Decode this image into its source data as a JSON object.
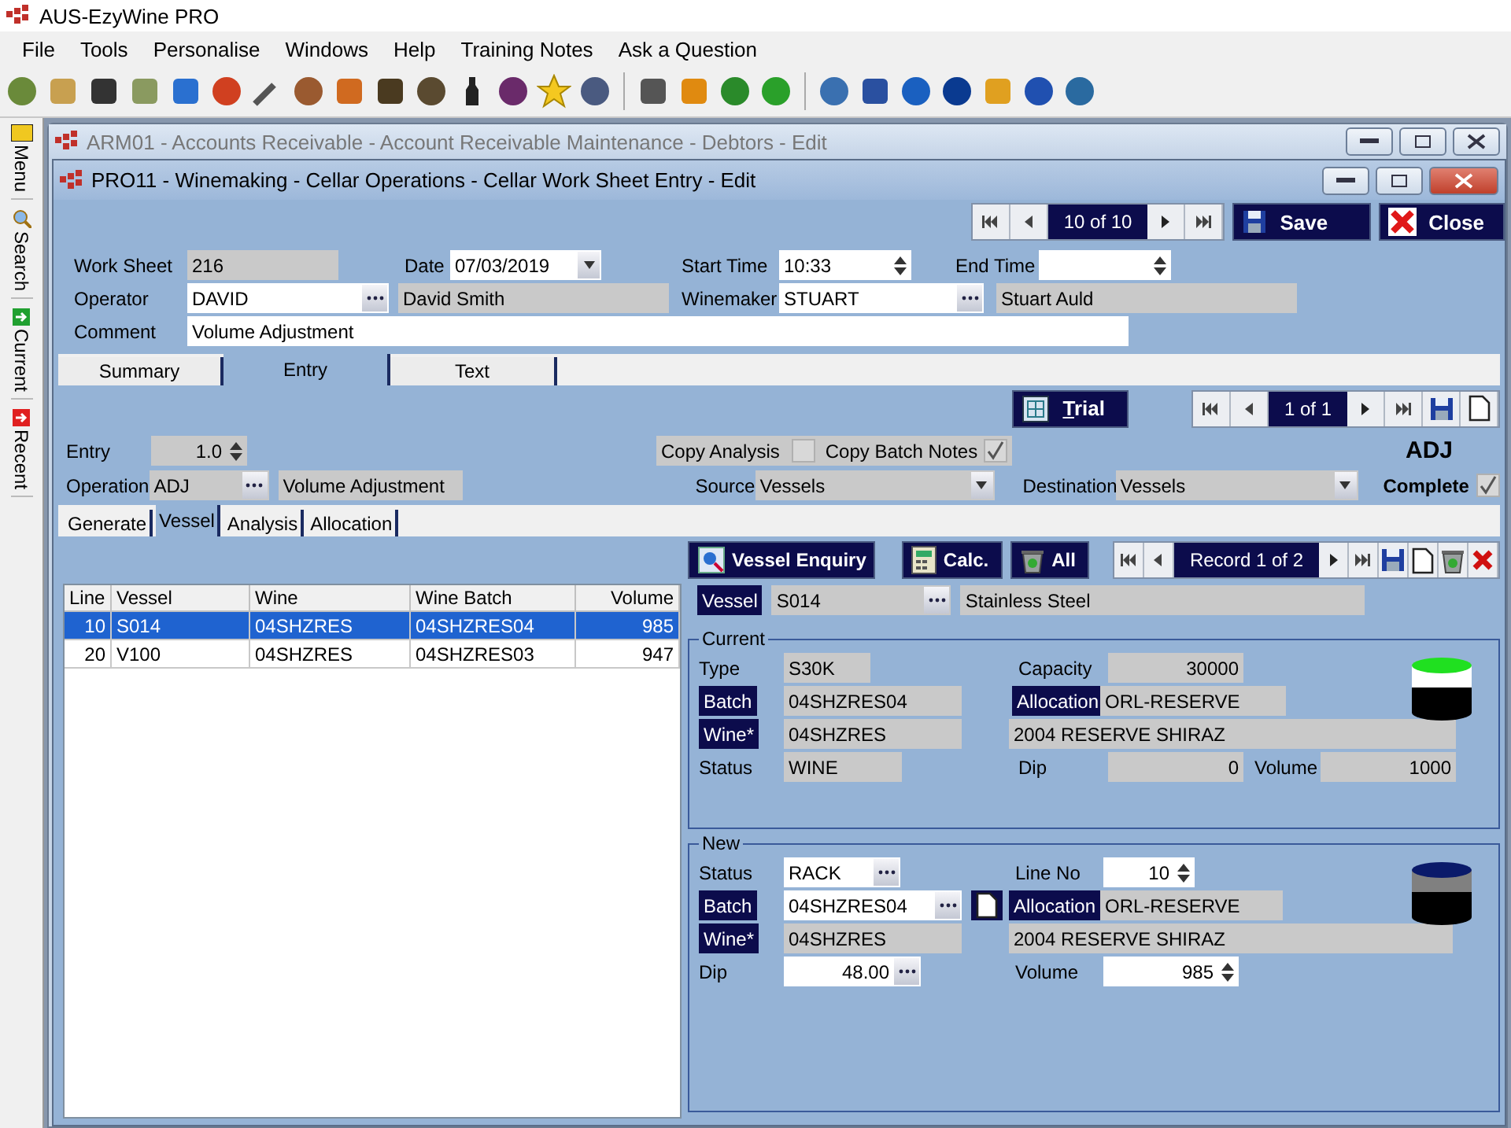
{
  "app": {
    "title": "AUS-EzyWine PRO",
    "menu": [
      "File",
      "Tools",
      "Personalise",
      "Windows",
      "Help",
      "Training Notes",
      "Ask a Question"
    ]
  },
  "sidebar": [
    {
      "label": "Menu"
    },
    {
      "label": "Search"
    },
    {
      "label": "Current"
    },
    {
      "label": "Recent"
    }
  ],
  "background_window": {
    "title": "ARM01 - Accounts Receivable - Account Receivable Maintenance - Debtors - Edit"
  },
  "window": {
    "title": "PRO11 - Winemaking - Cellar Operations - Cellar Work Sheet Entry - Edit",
    "record": "10 of 10",
    "buttons": [
      {
        "label": "Save",
        "kind": "save"
      },
      {
        "label": "Close",
        "kind": "close"
      }
    ]
  },
  "header": {
    "work_sheet": {
      "label": "Work Sheet",
      "value": "216"
    },
    "date": {
      "label": "Date",
      "value": "07/03/2019"
    },
    "start_time": {
      "label": "Start Time",
      "value": "10:33"
    },
    "end_time": {
      "label": "End Time"
    },
    "operator": {
      "label": "Operator",
      "value": "DAVID",
      "name": "David Smith"
    },
    "winemaker": {
      "label": "Winemaker",
      "value": "STUART",
      "name": "Stuart Auld"
    },
    "comment": {
      "label": "Comment",
      "value": "Volume Adjustment"
    }
  },
  "tabs": [
    {
      "label": "Summary",
      "selected": false
    },
    {
      "label": "Entry",
      "selected": true
    },
    {
      "label": "Text",
      "selected": false
    }
  ],
  "entry": {
    "trial_button": "Trial",
    "record": "1 of 1",
    "entry": {
      "label": "Entry",
      "value": "1.0"
    },
    "operation": {
      "label": "Operation",
      "value": "ADJ",
      "name": "Volume Adjustment"
    },
    "copy_analysis": {
      "label": "Copy Analysis",
      "checked": false
    },
    "copy_batch_notes": {
      "label": "Copy Batch Notes",
      "checked": true
    },
    "source": {
      "label": "Source",
      "value": "Vessels"
    },
    "destination": {
      "label": "Destination",
      "value": "Vessels"
    },
    "code": "ADJ",
    "complete": {
      "label": "Complete",
      "checked": true
    }
  },
  "subtabs": [
    {
      "label": "Generate",
      "selected": false
    },
    {
      "label": "Vessel",
      "selected": true
    },
    {
      "label": "Analysis",
      "selected": false
    },
    {
      "label": "Allocation",
      "selected": false
    }
  ],
  "lines": {
    "columns": [
      "Line",
      "Vessel",
      "Wine",
      "Wine Batch",
      "Volume"
    ],
    "rows": [
      {
        "cells": [
          "10",
          "S014",
          "04SHZRES",
          "04SHZRES04",
          "985"
        ],
        "selected": true
      },
      {
        "cells": [
          "20",
          "V100",
          "04SHZRES",
          "04SHZRES03",
          "947"
        ],
        "selected": false
      }
    ]
  },
  "vessel_panel": {
    "buttons": [
      {
        "label": "Vessel Enquiry",
        "kind": "enquiry"
      },
      {
        "label": "Calc.",
        "kind": "calc"
      },
      {
        "label": "All",
        "kind": "all"
      }
    ],
    "record": "Record 1 of 2",
    "vessel": {
      "label": "Vessel",
      "value": "S014",
      "name": "Stainless Steel"
    },
    "current": {
      "title": "Current",
      "type": {
        "label": "Type",
        "value": "S30K"
      },
      "capacity": {
        "label": "Capacity",
        "value": "30000"
      },
      "batch": {
        "label": "Batch",
        "value": "04SHZRES04"
      },
      "allocation": {
        "label": "Allocation",
        "value": "ORL-RESERVE"
      },
      "wine": {
        "label": "Wine*",
        "value": "04SHZRES",
        "name": "2004 RESERVE SHIRAZ"
      },
      "status": {
        "label": "Status",
        "value": "WINE"
      },
      "dip": {
        "label": "Dip",
        "value": "0"
      },
      "volume": {
        "label": "Volume",
        "value": "1000"
      }
    },
    "new": {
      "title": "New",
      "status": {
        "label": "Status",
        "value": "RACK"
      },
      "line_no": {
        "label": "Line No",
        "value": "10"
      },
      "batch": {
        "label": "Batch",
        "value": "04SHZRES04"
      },
      "allocation": {
        "label": "Allocation",
        "value": "ORL-RESERVE"
      },
      "wine": {
        "label": "Wine*",
        "value": "04SHZRES",
        "name": "2004 RESERVE SHIRAZ"
      },
      "dip": {
        "label": "Dip",
        "value": "48.00"
      },
      "volume": {
        "label": "Volume",
        "value": "985"
      }
    }
  }
}
